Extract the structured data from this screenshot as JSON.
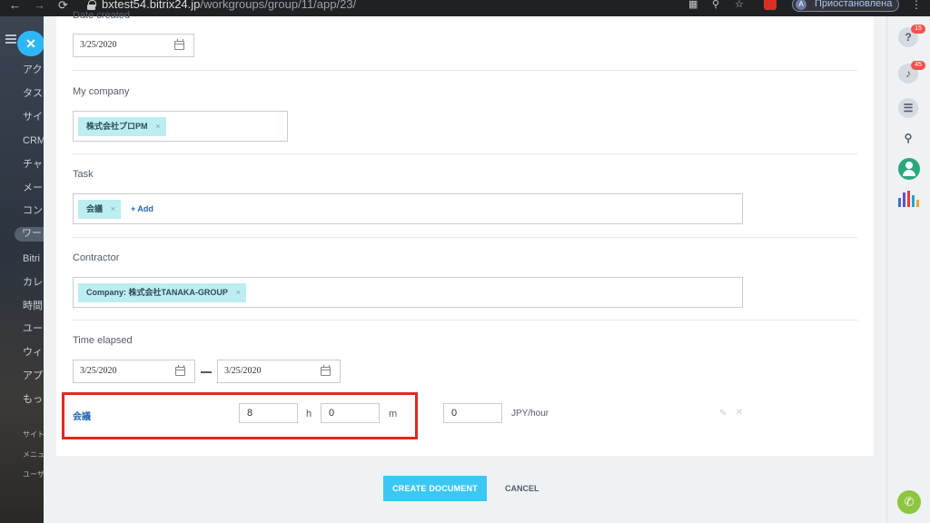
{
  "browser": {
    "url_host": "bxtest54.bitrix24.jp",
    "url_path": "/workgroups/group/11/app/23/",
    "profile_initial": "A",
    "profile_status": "Приостановлена"
  },
  "left_menu": {
    "items": [
      "アク",
      "タス",
      "サイ",
      "CRM",
      "チャ",
      "メー",
      "コン",
      "ワー",
      "Bitri",
      "カレ",
      "時間",
      "ユー",
      "ウィ",
      "アプ",
      "もっ"
    ],
    "small_items": [
      "サイト",
      "メニュ",
      "ユーザ"
    ]
  },
  "form": {
    "date_created": {
      "label": "Date created",
      "value": "3/25/2020"
    },
    "my_company": {
      "label": "My company",
      "tag": "株式会社プロPM"
    },
    "task": {
      "label": "Task",
      "tag": "会議",
      "add_label": "+ Add"
    },
    "contractor": {
      "label": "Contractor",
      "tag": "Company: 株式会社TANAKA-GROUP"
    },
    "time_elapsed": {
      "label": "Time elapsed",
      "from": "3/25/2020",
      "to": "3/25/2020",
      "row": {
        "task_link": "会議",
        "hours": "8",
        "hours_unit": "h",
        "minutes": "0",
        "minutes_unit": "m",
        "rate": "0",
        "rate_unit": "JPY/hour"
      }
    },
    "tag_remove": "×"
  },
  "buttons": {
    "create": "CREATE DOCUMENT",
    "cancel": "CANCEL"
  },
  "right_panel": {
    "help_badge": "15",
    "notifications_badge": "45"
  },
  "colors": {
    "accent": "#3bc8f5",
    "tag_bg": "#bcedf1",
    "link": "#2067b0",
    "highlight": "#e0291f"
  }
}
